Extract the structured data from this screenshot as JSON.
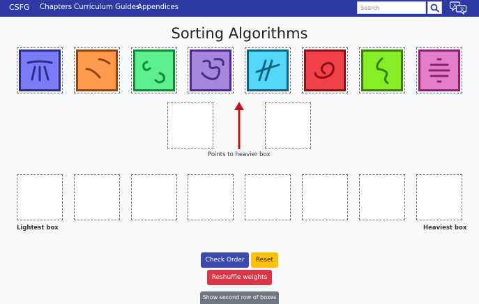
{
  "navbar": {
    "brand": "CSFG",
    "links": [
      "Chapters",
      "Curriculum Guides",
      "Appendices"
    ],
    "search_placeholder": "Search",
    "search_icon": "search-icon",
    "language_icon": "translate-icon",
    "color": "#2d3aa6"
  },
  "page": {
    "title": "Sorting Algorithms"
  },
  "boxes": [
    {
      "color": "#7a7cf7",
      "border": "#2b2c88",
      "glyph": "#2b2c88"
    },
    {
      "color": "#ff9a4f",
      "border": "#8e4411",
      "glyph": "#8e4411"
    },
    {
      "color": "#5ef08e",
      "border": "#0e8a35",
      "glyph": "#0e8a35"
    },
    {
      "color": "#a686df",
      "border": "#4b2a8a",
      "glyph": "#4b2a8a"
    },
    {
      "color": "#53d8fb",
      "border": "#13617c",
      "glyph": "#13617c"
    },
    {
      "color": "#f24149",
      "border": "#891018",
      "glyph": "#891018"
    },
    {
      "color": "#86ee25",
      "border": "#3c7d08",
      "glyph": "#3c7d08"
    },
    {
      "color": "#e37fc9",
      "border": "#8c1f74",
      "glyph": "#8c1f74"
    }
  ],
  "scale": {
    "caption": "Points to heavier box",
    "arrow_color": "#c0141a"
  },
  "results": {
    "lightest_label": "Lightest box",
    "heaviest_label": "Heaviest box"
  },
  "buttons": {
    "check_order": "Check Order",
    "reset": "Reset",
    "reshuffle": "Reshuffle weights",
    "second_row": "Show second row of boxes"
  }
}
